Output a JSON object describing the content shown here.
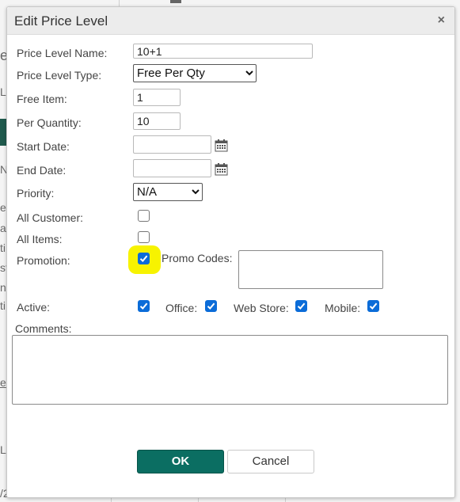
{
  "dialog": {
    "title": "Edit Price Level",
    "close_glyph": "×"
  },
  "form": {
    "price_level_name": {
      "label": "Price Level Name:",
      "value": "10+1"
    },
    "price_level_type": {
      "label": "Price Level Type:",
      "selected": "Free Per Qty"
    },
    "free_item": {
      "label": "Free Item:",
      "value": "1"
    },
    "per_quantity": {
      "label": "Per Quantity:",
      "value": "10"
    },
    "start_date": {
      "label": "Start Date:",
      "value": ""
    },
    "end_date": {
      "label": "End Date:",
      "value": ""
    },
    "priority": {
      "label": "Priority:",
      "selected": "N/A"
    },
    "all_customer": {
      "label": "All Customer:",
      "checked": false
    },
    "all_items": {
      "label": "All Items:",
      "checked": false
    },
    "promotion": {
      "label": "Promotion:",
      "checked": true,
      "highlight_color": "#f7f300"
    },
    "promo_codes": {
      "label": "Promo Codes:",
      "value": ""
    },
    "active": {
      "label": "Active:",
      "checked": true
    },
    "office": {
      "label": "Office:",
      "checked": true
    },
    "web_store": {
      "label": "Web Store:",
      "checked": true
    },
    "mobile": {
      "label": "Mobile:",
      "checked": true
    },
    "comments": {
      "label": "Comments:",
      "value": ""
    }
  },
  "buttons": {
    "ok": "OK",
    "cancel": "Cancel"
  },
  "icons": {
    "calendar": "calendar-icon",
    "dropdown": "chevron-down-icon",
    "check": "checkmark-icon"
  },
  "colors": {
    "accent": "#0b6e62",
    "checkbox": "#0b6cd8"
  }
}
